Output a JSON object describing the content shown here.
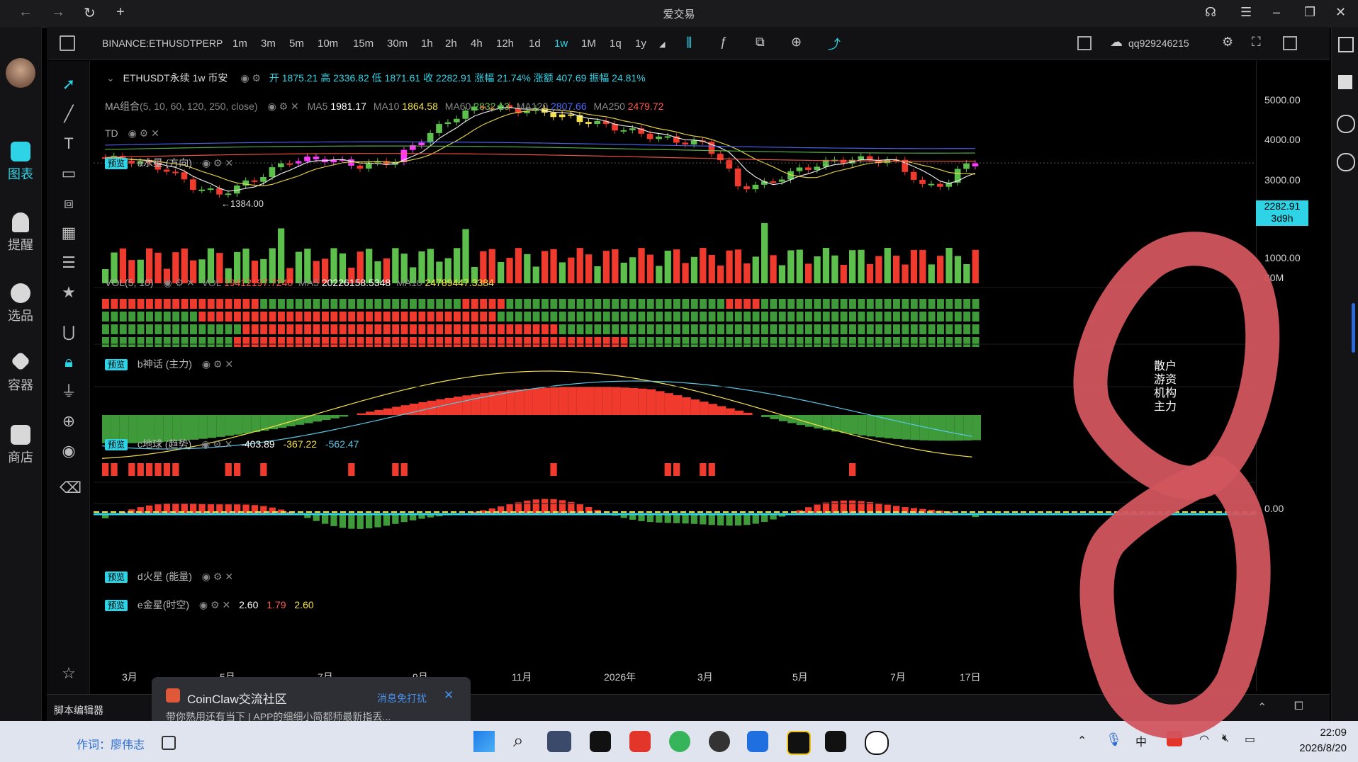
{
  "window": {
    "title": "爱交易"
  },
  "leftnav": {
    "items": [
      {
        "label": "图表",
        "icon": "chart-icon"
      },
      {
        "label": "提醒",
        "icon": "bell-icon"
      },
      {
        "label": "选品",
        "icon": "search-chart-icon"
      },
      {
        "label": "容器",
        "icon": "diamond-icon"
      },
      {
        "label": "商店",
        "icon": "shop-icon"
      }
    ]
  },
  "toolbar": {
    "symbol": "BINANCE:ETHUSDTPERP",
    "timeframes": [
      "1m",
      "3m",
      "5m",
      "10m",
      "15m",
      "30m",
      "1h",
      "2h",
      "4h",
      "12h",
      "1d",
      "1w",
      "1M",
      "1q",
      "1y"
    ],
    "active_timeframe": "1w",
    "user": "qq929246215"
  },
  "legend": {
    "main": {
      "name": "ETHUSDT永续 1w 币安",
      "text": "开 1875.21 高 2336.82 低 1871.61 收 2282.91 涨幅 21.74% 涨额 407.69 振幅 24.81%"
    },
    "ma": {
      "name": "MA组合",
      "params": "(5, 10, 60, 120, 250, close)",
      "ma5_label": "MA5",
      "ma5": "1981.17",
      "ma10_label": "MA10",
      "ma10": "1864.58",
      "ma60_label": "MA60",
      "ma60": "2832.13",
      "ma120_label": "MA120",
      "ma120": "2807.66",
      "ma250_label": "MA250",
      "ma250": "2479.72"
    },
    "td": {
      "name": "TD"
    },
    "a": {
      "tag": "预览",
      "name": "a水星 (方向)"
    },
    "vol": {
      "name": "VOL(5, 10)",
      "vol_label": "VOL",
      "vol": "19412197.7240",
      "ma5_label": "MA5",
      "ma5": "20226158.5348",
      "ma10_label": "MA10",
      "ma10": "24789447.3384"
    },
    "b": {
      "tag": "预览",
      "name": "b神话 (主力)",
      "rows": [
        "散户",
        "游资",
        "机构",
        "主力"
      ]
    },
    "c": {
      "tag": "预览",
      "name": "c地球 (趋势)",
      "v1": "-403.89",
      "v2": "-367.22",
      "v3": "-562.47"
    },
    "d": {
      "tag": "预览",
      "name": "d火星 (能量)"
    },
    "e": {
      "tag": "预览",
      "name": "e金星(时空)",
      "v1": "2.60",
      "v2": "1.79",
      "v3": "2.60"
    }
  },
  "price_scale": {
    "labels": [
      "5000.00",
      "4000.00",
      "3000.00",
      "1000.00"
    ],
    "current": "2282.91",
    "countdown": "3d9h",
    "vol_top": "80M",
    "c_labels": [
      "0.00"
    ],
    "colors": {
      "current_bg": "#2ed3e6"
    }
  },
  "chart_annotations": {
    "low_label": "1384.00"
  },
  "time_axis": [
    "3月",
    "5月",
    "7月",
    "9月",
    "11月",
    "2026年",
    "3月",
    "5月",
    "7月",
    "17日"
  ],
  "bottom": {
    "script_editor": "脚本编辑器"
  },
  "notification": {
    "title": "CoinClaw交流社区",
    "action": "消息免打扰",
    "preview": "带你熟用还有当下 | APP的细细小简都师最新指丢..."
  },
  "taskbar": {
    "composer_label": "作词：廖伟志",
    "time": "22:09",
    "date": "2026/8/20"
  },
  "overlay": {
    "drawing": "8"
  }
}
